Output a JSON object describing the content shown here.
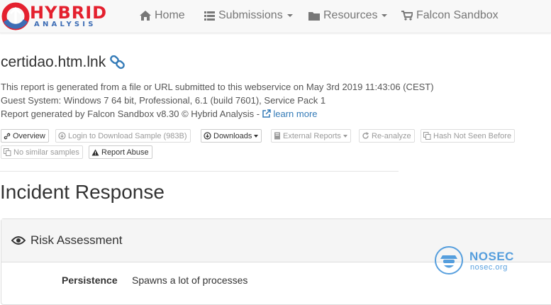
{
  "colors": {
    "brand_red": "#e4202e",
    "brand_blue": "#3d6db5",
    "link": "#337ab7",
    "navbar_bg": "#f8f8f8",
    "panel_heading_bg": "#f5f5f5",
    "watermark": "#3a8fd9"
  },
  "logo": {
    "main": "HYBRID",
    "sub": "ANALYSIS"
  },
  "nav": {
    "items": [
      {
        "label": "Home",
        "icon": "home-icon",
        "dropdown": false
      },
      {
        "label": "Submissions",
        "icon": "list-icon",
        "dropdown": true
      },
      {
        "label": "Resources",
        "icon": "folder-icon",
        "dropdown": true
      },
      {
        "label": "Falcon Sandbox",
        "icon": "cart-icon",
        "dropdown": false
      }
    ]
  },
  "report": {
    "filename": "certidao.htm.lnk",
    "line1": "This report is generated from a file or URL submitted to this webservice on May 3rd 2019 11:43:06 (CEST)",
    "line2": "Guest System: Windows 7 64 bit, Professional, 6.1 (build 7601), Service Pack 1",
    "line3_prefix": "Report generated by Falcon Sandbox v8.30 © Hybrid Analysis - ",
    "learn_more": "learn more"
  },
  "buttons": [
    {
      "label": "Overview",
      "icon": "link-icon",
      "disabled": false
    },
    {
      "label": "Login to Download Sample (983B)",
      "icon": "download-circle-icon",
      "disabled": true
    },
    {
      "label": "Downloads",
      "icon": "download-circle-icon",
      "disabled": false
    },
    {
      "label": "External Reports",
      "icon": "book-icon",
      "disabled": true
    },
    {
      "label": "Re-analyze",
      "icon": "refresh-icon",
      "disabled": true
    },
    {
      "label": "Hash Not Seen Before",
      "icon": "copy-icon",
      "disabled": true
    },
    {
      "label": "No similar samples",
      "icon": "copy-icon",
      "disabled": true
    },
    {
      "label": "Report Abuse",
      "icon": "warning-icon",
      "disabled": false
    }
  ],
  "section": {
    "title": "Incident Response"
  },
  "panel": {
    "title": "Risk Assessment",
    "rows": [
      {
        "label": "Persistence",
        "value": "Spawns a lot of processes"
      }
    ]
  },
  "watermark": {
    "title": "NOSEC",
    "sub": "nosec.org"
  }
}
